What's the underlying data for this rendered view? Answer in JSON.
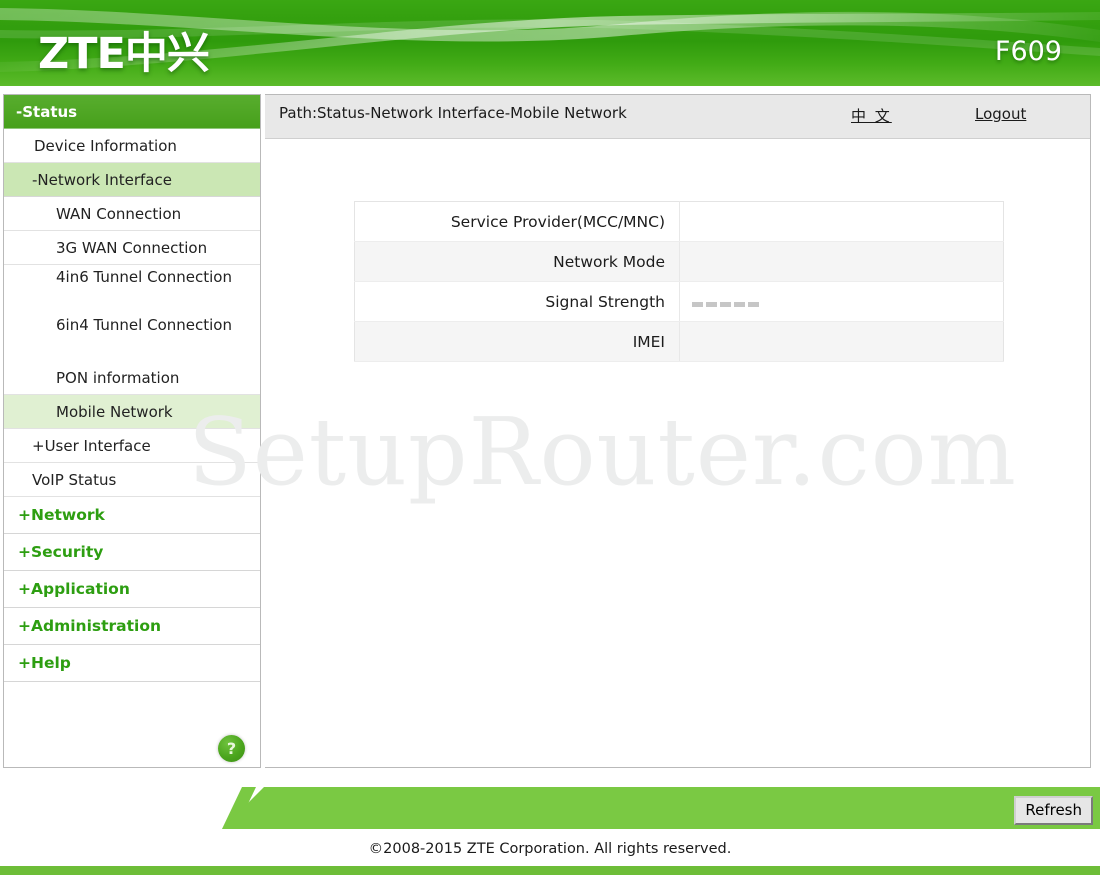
{
  "header": {
    "logo_text": "ZTE中兴",
    "model": "F609"
  },
  "sidebar": {
    "items": [
      {
        "label": "-Status",
        "kind": "head-open"
      },
      {
        "label": "Device Information",
        "kind": "lvl1"
      },
      {
        "label": "-Network Interface",
        "kind": "sub-open"
      },
      {
        "label": "WAN Connection",
        "kind": "lvl2"
      },
      {
        "label": "3G WAN Connection",
        "kind": "lvl2"
      },
      {
        "label": "4in6 Tunnel Connection",
        "kind": "lvl2-two"
      },
      {
        "label": "6in4 Tunnel Connection",
        "kind": "lvl2-two"
      },
      {
        "label": "PON information",
        "kind": "lvl2"
      },
      {
        "label": "Mobile Network",
        "kind": "selected"
      },
      {
        "label": "+User Interface",
        "kind": "plus-sub"
      },
      {
        "label": "VoIP Status",
        "kind": "plus-sub"
      },
      {
        "label": "+Network",
        "kind": "top"
      },
      {
        "label": "+Security",
        "kind": "top"
      },
      {
        "label": "+Application",
        "kind": "top"
      },
      {
        "label": "+Administration",
        "kind": "top"
      },
      {
        "label": "+Help",
        "kind": "top"
      }
    ],
    "help_icon_glyph": "?"
  },
  "content": {
    "path": "Path:Status-Network Interface-Mobile Network",
    "language_link": "中 文",
    "logout_link": "Logout",
    "table": {
      "rows": [
        {
          "label": "Service Provider(MCC/MNC)",
          "value": ""
        },
        {
          "label": "Network Mode",
          "value": ""
        },
        {
          "label": "Signal Strength",
          "value": "-----"
        },
        {
          "label": "IMEI",
          "value": ""
        }
      ]
    }
  },
  "watermark": "SetupRouter.com",
  "footer": {
    "refresh_label": "Refresh",
    "copyright": "©2008-2015 ZTE Corporation. All rights reserved."
  },
  "colors": {
    "brand_green": "#3aa713",
    "header_dark": "#2f9b0c",
    "selected_row": "#e0f0d2",
    "open_section": "#cbe7b4",
    "footer_band": "#7ac943",
    "plus_green": "#2d9e11"
  }
}
